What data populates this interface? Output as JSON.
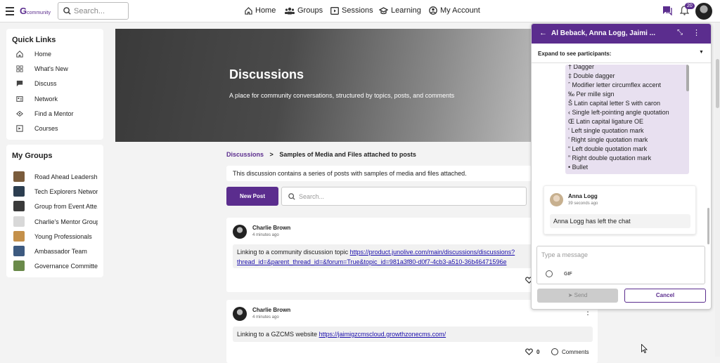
{
  "topbar": {
    "logo_text": "community",
    "search_placeholder": "Search...",
    "nav": [
      "Home",
      "Groups",
      "Sessions",
      "Learning",
      "My Account"
    ],
    "notification_count": "20"
  },
  "quick_links": {
    "title": "Quick Links",
    "items": [
      "Home",
      "What's New",
      "Discuss",
      "Network",
      "Find a Mentor",
      "Courses"
    ]
  },
  "my_groups": {
    "title": "My Groups",
    "items": [
      "Road Ahead Leadership",
      "Tech Explorers Network",
      "Group from Event Atte...",
      "Charlie's Mentor Group",
      "Young Professionals",
      "Ambassador Team",
      "Governance Committee"
    ]
  },
  "hero": {
    "title": "Discussions",
    "subtitle": "A place for community conversations, structured by topics, posts, and comments"
  },
  "breadcrumb": {
    "root": "Discussions",
    "sep": ">",
    "current": "Samples of Media and Files attached to posts"
  },
  "info": "This discussion contains a series of posts with samples of media and files attached.",
  "new_post_label": "New Post",
  "search_placeholder": "Search...",
  "posts": [
    {
      "author": "Charlie Brown",
      "time": "4 minutes ago",
      "text": "Linking to a community discussion topic ",
      "link_line1": "https://product.junolive.com/main/discussions/discussions?",
      "link_line2": "thread_id=&parent_thread_id=&forum=True&topic_id=981a3f80-d0f7-4cb3-a510-36b46471596e"
    },
    {
      "author": "Charlie Brown",
      "time": "4 minutes ago",
      "text": "Linking to a GZCMS website ",
      "link": "https://jaimigzcmscloud.growthzonecms.com/",
      "likes": "0",
      "comments_label": "Comments"
    }
  ],
  "chat": {
    "title": "Al Beback, Anna Logg, Jaimi ...",
    "expand_label": "Expand to see participants:",
    "char_list": [
      "† Dagger",
      "‡ Double dagger",
      "ˆ Modifier letter circumflex accent",
      "‰ Per mille sign",
      "Š Latin capital letter S with caron",
      "‹ Single left-pointing angle quotation",
      "Œ Latin capital ligature OE",
      "‘ Left single quotation mark",
      "’ Right single quotation mark",
      "“ Left double quotation mark",
      "” Right double quotation mark",
      "• Bullet"
    ],
    "message": {
      "author": "Anna Logg",
      "time": "39 seconds ago",
      "text": "Anna Logg has left the chat"
    },
    "input_placeholder": "Type a message",
    "gif_label": "GIF",
    "send_label": "Send",
    "cancel_label": "Cancel"
  },
  "colors": {
    "brand": "#5b2d8e",
    "link": "#1a0dab"
  }
}
